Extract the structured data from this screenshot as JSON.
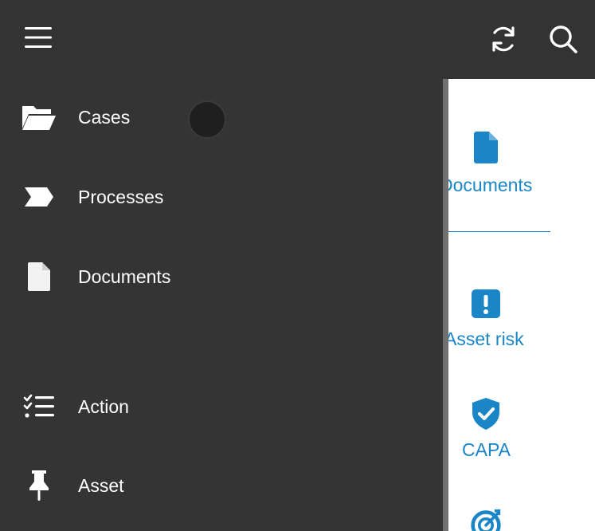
{
  "colors": {
    "topbar_bg": "#333333",
    "drawer_bg": "#343434",
    "drawer_text": "#ffffff",
    "accent": "#1a86c8",
    "content_bg": "#ffffff"
  },
  "topbar": {
    "menu_icon": "hamburger-menu-icon",
    "refresh_icon": "refresh-icon",
    "search_icon": "search-icon"
  },
  "drawer": {
    "items": [
      {
        "label": "Cases",
        "icon": "folder-open-icon"
      },
      {
        "label": "Processes",
        "icon": "process-chevron-icon"
      },
      {
        "label": "Documents",
        "icon": "file-icon"
      },
      {
        "label": "Action",
        "icon": "checklist-icon"
      },
      {
        "label": "Asset",
        "icon": "pin-icon"
      }
    ]
  },
  "content": {
    "tiles": [
      {
        "label": "Documents",
        "icon": "file-icon"
      },
      {
        "label": "Asset risk",
        "icon": "exclamation-square-icon"
      },
      {
        "label": "CAPA",
        "icon": "shield-check-icon"
      },
      {
        "label": "",
        "icon": "target-icon"
      }
    ]
  }
}
